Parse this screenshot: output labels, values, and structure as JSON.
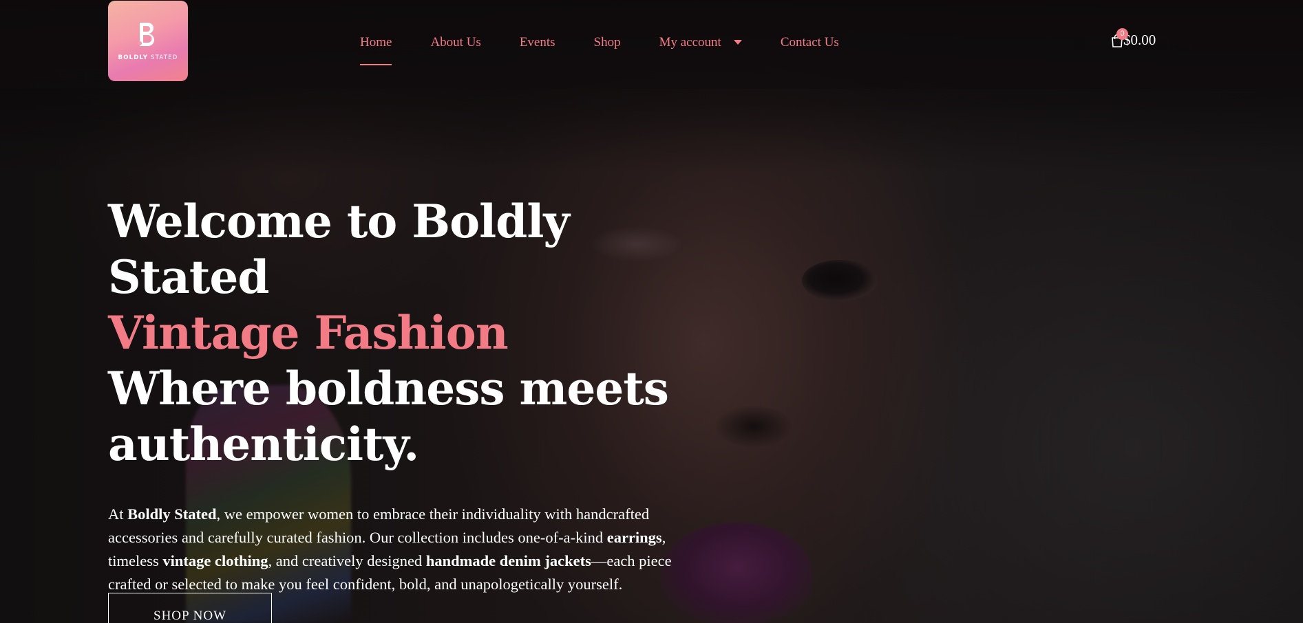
{
  "brand": {
    "logo_letter": "B",
    "logo_text_bold": "BOLDLY",
    "logo_text_light": " STATED",
    "accent_color": "#f27b86"
  },
  "nav": {
    "items": [
      {
        "label": "Home",
        "active": true
      },
      {
        "label": "About Us"
      },
      {
        "label": "Events"
      },
      {
        "label": "Shop"
      },
      {
        "label": "My account",
        "has_dropdown": true
      },
      {
        "label": "Contact Us"
      }
    ]
  },
  "cart": {
    "icon": "shopping-bag-icon",
    "count": "0",
    "total": "$0.00"
  },
  "hero": {
    "headline_line1": "Welcome to Boldly Stated",
    "headline_accent": "Vintage Fashion",
    "headline_line3": "Where boldness meets",
    "headline_line4": "authenticity.",
    "intro": {
      "p1": "At ",
      "b1": "Boldly Stated",
      "p2": ", we empower women to embrace their individuality with handcrafted accessories and carefully curated fashion. Our collection includes one-of-a-kind ",
      "b2": "earrings",
      "p3": ", timeless ",
      "b3": "vintage clothing",
      "p4": ", and creatively designed ",
      "b4": "handmade denim jackets",
      "p5": "—each piece crafted or selected to make you feel confident, bold, and unapologetically yourself."
    },
    "cta_label": "SHOP NOW"
  }
}
